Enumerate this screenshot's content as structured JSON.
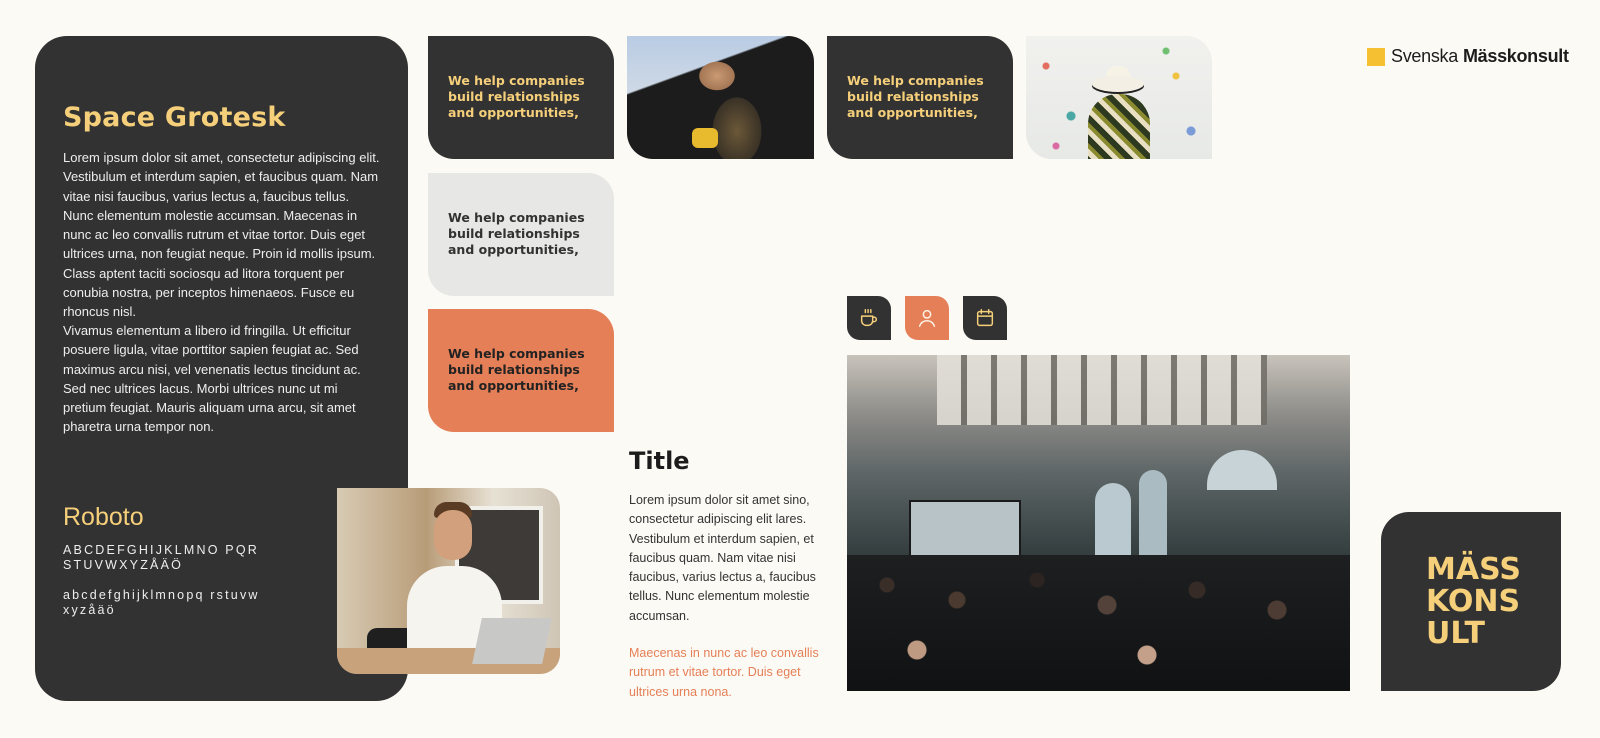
{
  "brand": {
    "name_light": "Svenska",
    "name_bold": "Mässkonsult",
    "accent_color": "#f5c132"
  },
  "typography": {
    "primary_font_name": "Space Grotesk",
    "paragraph1": "Lorem ipsum dolor sit amet, consectetur adipiscing elit. Vestibulum et interdum sapien, et faucibus quam. Nam vitae nisi faucibus, varius lectus a, faucibus tellus. Nunc elementum molestie accumsan. Maecenas in nunc ac leo convallis rutrum et vitae tortor. Duis eget ultrices urna, non feugiat neque. Proin id mollis ipsum. Class aptent taciti sociosqu ad litora torquent per conubia nostra, per inceptos himenaeos. Fusce eu rhoncus nisl.",
    "paragraph2": "Vivamus elementum a libero id fringilla. Ut efficitur posuere ligula, vitae porttitor sapien feugiat ac. Sed maximus arcu nisi, vel venenatis lectus tincidunt ac. Sed nec ultrices lacus. Morbi ultrices nunc ut mi pretium feugiat. Mauris aliquam urna arcu, sit amet pharetra urna tempor non.",
    "secondary_font_name": "Roboto",
    "uppercase_alphabet": "ABCDEFGHIJKLMNO PQRSTUVWXYZÅÄÖ",
    "lowercase_alphabet": "abcdefghijklmnopq rstuvwxyzåäö"
  },
  "cards": [
    {
      "text": "We help companies build relationships and opportunities,",
      "variant": "dark"
    },
    {
      "text": "We help companies build relationships and opportunities,",
      "variant": "dark"
    },
    {
      "text": "We help companies build relationships and opportunities,",
      "variant": "light"
    },
    {
      "text": "We help companies build relationships and opportunities,",
      "variant": "orange"
    }
  ],
  "icons": [
    {
      "name": "coffee-cup-icon",
      "variant": "dark"
    },
    {
      "name": "user-icon",
      "variant": "orange"
    },
    {
      "name": "calendar-icon",
      "variant": "dark"
    }
  ],
  "content": {
    "title": "Title",
    "body": "Lorem ipsum dolor sit amet sino, consectetur adipiscing elit lares. Vestibulum et interdum sapien, et faucibus quam. Nam vitae nisi faucibus, varius lectus a, faucibus tellus. Nunc elementum molestie accumsan.",
    "highlight": "Maecenas in nunc ac leo convallis rutrum et vitae tortor. Duis eget ultrices urna nona."
  },
  "logo_mark": {
    "line1": "MÄSS",
    "line2": "KONS",
    "line3": "ULT"
  },
  "colors": {
    "background": "#fcfaf4",
    "dark": "#323232",
    "yellow": "#f5cf7a",
    "orange": "#e57f57",
    "light_gray": "#e7e7e5"
  }
}
